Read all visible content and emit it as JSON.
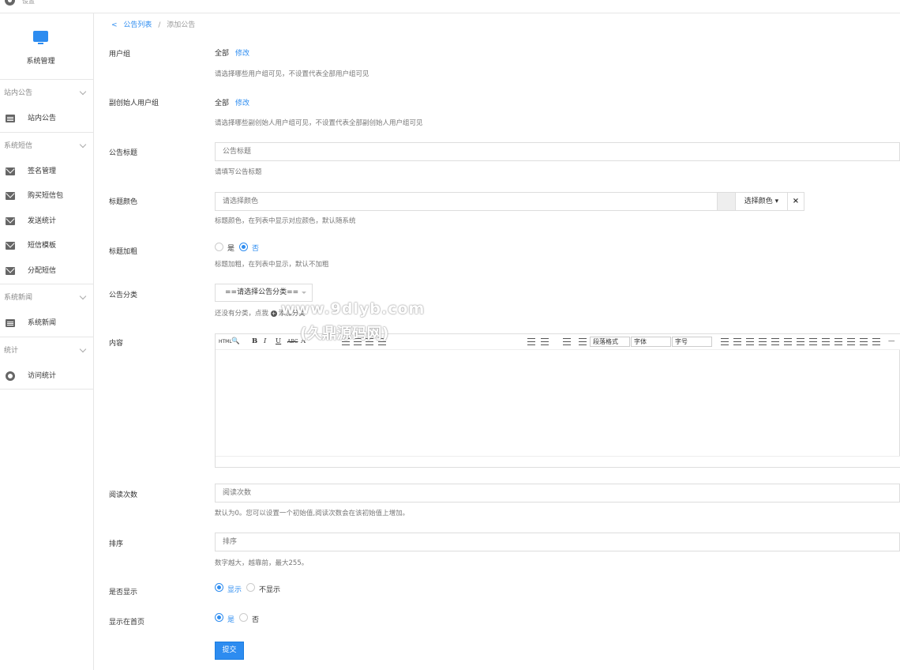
{
  "top": {
    "name": "设置"
  },
  "sidebar": {
    "system_title": "系统管理",
    "sections": [
      {
        "title": "站内公告",
        "items": [
          {
            "label": "站内公告",
            "icon": "doc-icon"
          }
        ]
      },
      {
        "title": "系统短信",
        "items": [
          {
            "label": "签名管理",
            "icon": "mail-icon"
          },
          {
            "label": "购买短信包",
            "icon": "mail-icon"
          },
          {
            "label": "发送统计",
            "icon": "mail-icon"
          },
          {
            "label": "短信模板",
            "icon": "mail-icon"
          },
          {
            "label": "分配短信",
            "icon": "mail-icon"
          }
        ]
      },
      {
        "title": "系统新闻",
        "items": [
          {
            "label": "系统新闻",
            "icon": "doc-icon"
          }
        ]
      },
      {
        "title": "统计",
        "items": [
          {
            "label": "访问统计",
            "icon": "chart-icon"
          }
        ]
      }
    ]
  },
  "breadcrumb": {
    "back": "<",
    "parent": "公告列表",
    "sep": "/",
    "current": "添加公告"
  },
  "form": {
    "user_group": {
      "label": "用户组",
      "value": "全部",
      "edit": "修改",
      "help": "请选择哪些用户组可见，不设置代表全部用户组可见"
    },
    "founder_group": {
      "label": "副创始人用户组",
      "value": "全部",
      "edit": "修改",
      "help": "请选择哪些副创始人用户组可见，不设置代表全部副创始人用户组可见"
    },
    "title": {
      "label": "公告标题",
      "placeholder": "公告标题",
      "help": "请填写公告标题"
    },
    "title_color": {
      "label": "标题颜色",
      "placeholder": "请选择颜色",
      "button": "选择颜色 ▾",
      "clear": "×",
      "help": "标题颜色，在列表中显示对应颜色，默认随系统"
    },
    "title_bold": {
      "label": "标题加粗",
      "yes": "是",
      "no": "否",
      "help": "标题加粗，在列表中显示，默认不加粗"
    },
    "category": {
      "label": "公告分类",
      "select": "==请选择公告分类==",
      "help_prefix": "还没有分类，点我",
      "help_link": "添加分类"
    },
    "content": {
      "label": "内容"
    },
    "toolbar": {
      "html": "HTML",
      "b": "B",
      "i": "I",
      "u": "U",
      "abc": "ABC",
      "a": "A",
      "paragraph": "段落格式",
      "font": "字体",
      "size": "字号"
    },
    "read_count": {
      "label": "阅读次数",
      "placeholder": "阅读次数",
      "help": "默认为0。您可以设置一个初始值,阅读次数会在该初始值上增加。"
    },
    "sort": {
      "label": "排序",
      "placeholder": "排序",
      "help": "数字越大，越靠前，最大255。"
    },
    "display": {
      "label": "是否显示",
      "yes": "显示",
      "no": "不显示"
    },
    "homepage": {
      "label": "显示在首页",
      "yes": "是",
      "no": "否"
    },
    "submit": "提交"
  },
  "watermark": {
    "line1": "www.9dlyb.com",
    "line2": "(久鼎源码网)"
  }
}
